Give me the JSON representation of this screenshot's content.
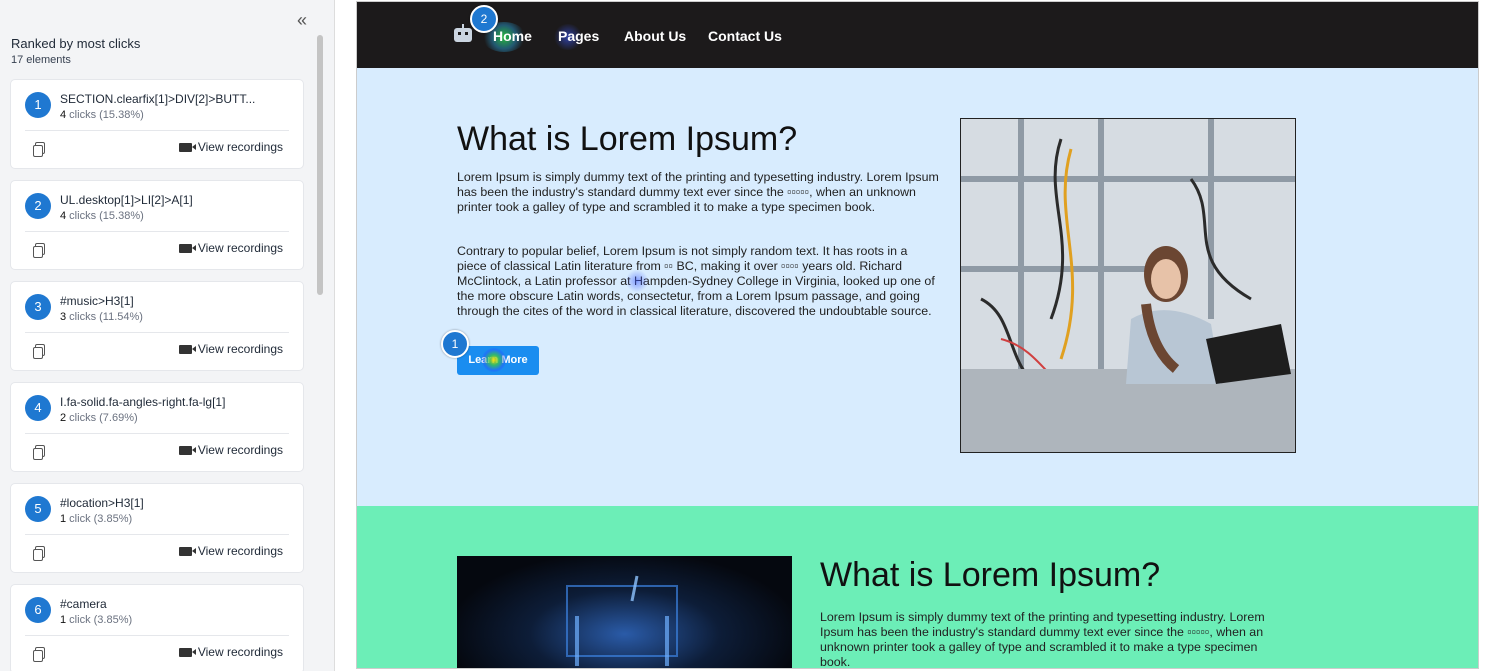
{
  "sidebar": {
    "collapse_icon": "double-chevron-left-icon",
    "title": "Ranked by most clicks",
    "subtitle": "17 elements",
    "view_label": "View recordings",
    "items": [
      {
        "rank": "1",
        "selector": "SECTION.clearfix[1]>DIV[2]>BUTT...",
        "count": "4",
        "unit": " clicks (15.38%)"
      },
      {
        "rank": "2",
        "selector": "UL.desktop[1]>LI[2]>A[1]",
        "count": "4",
        "unit": " clicks (15.38%)"
      },
      {
        "rank": "3",
        "selector": "#music>H3[1]",
        "count": "3",
        "unit": " clicks (11.54%)"
      },
      {
        "rank": "4",
        "selector": "I.fa-solid.fa-angles-right.fa-lg[1]",
        "count": "2",
        "unit": " clicks (7.69%)"
      },
      {
        "rank": "5",
        "selector": "#location>H3[1]",
        "count": "1",
        "unit": " click (3.85%)"
      },
      {
        "rank": "6",
        "selector": "#camera",
        "count": "1",
        "unit": " click (3.85%)"
      }
    ]
  },
  "site": {
    "nav": {
      "logo_icon": "robot-icon",
      "links": [
        "Home",
        "Pages",
        "About Us",
        "Contact Us"
      ]
    },
    "hero": {
      "heading": "What is Lorem Ipsum?",
      "p1": "Lorem Ipsum is simply dummy text of the printing and typesetting industry. Lorem Ipsum has been the industry's standard dummy text ever since the ▫▫▫▫▫, when an unknown printer took a galley of type and scrambled it to make a type specimen book.",
      "p2": "Contrary to popular belief, Lorem Ipsum is not simply random text. It has roots in a piece of classical Latin literature from ▫▫ BC, making it over ▫▫▫▫ years old. Richard McClintock, a Latin professor at Hampden-Sydney College in Virginia, looked up one of the more obscure Latin words, consectetur, from a Lorem Ipsum passage, and going through the cites of the word in classical literature, discovered the undoubtable source.",
      "button": "Learn More"
    },
    "section2": {
      "heading": "What is Lorem Ipsum?",
      "p1": "Lorem Ipsum is simply dummy text of the printing and typesetting industry. Lorem Ipsum has been the industry's standard dummy text ever since the ▫▫▫▫▫, when an unknown printer took a galley of type and scrambled it to make a type specimen book."
    },
    "badges": {
      "learn_more": "1",
      "home": "2"
    }
  }
}
